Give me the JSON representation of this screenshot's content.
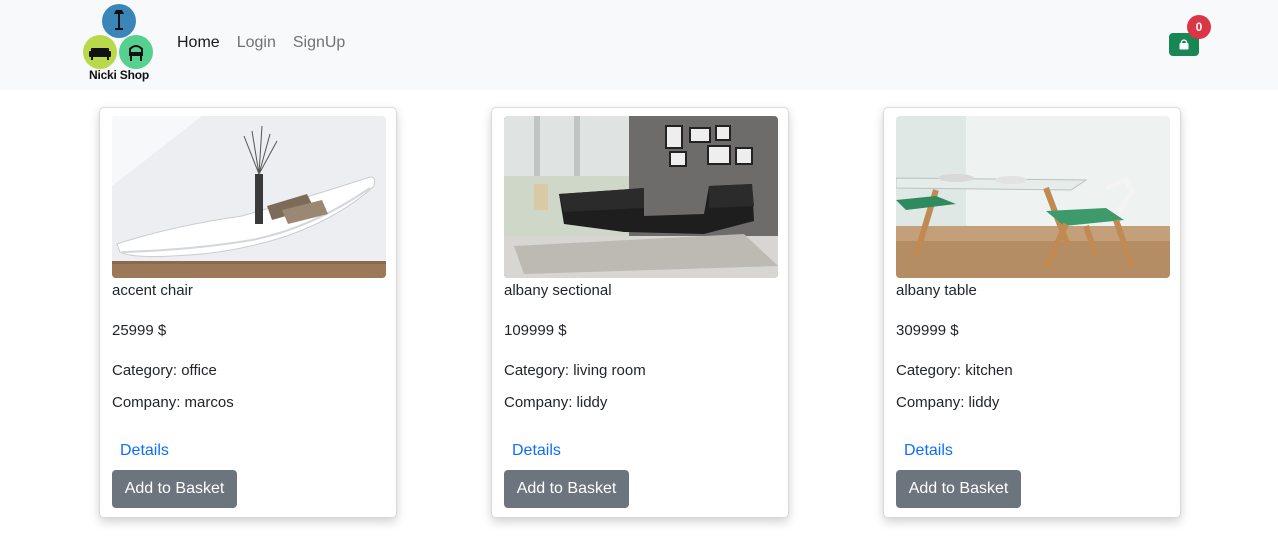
{
  "brand": {
    "name": "Nicki Shop"
  },
  "nav": {
    "items": [
      "Home",
      "Login",
      "SignUp"
    ],
    "active": "Home"
  },
  "cart": {
    "count": "0",
    "icon": "bag-icon",
    "color": "#198754",
    "badge_color": "#dc3545"
  },
  "products": [
    {
      "title": "accent chair",
      "price": "25999 $",
      "category": "Category: office",
      "company": "Company: marcos",
      "details_label": "Details",
      "button_label": "Add to Basket"
    },
    {
      "title": "albany sectional",
      "price": "109999 $",
      "category": "Category: living room",
      "company": "Company: liddy",
      "details_label": "Details",
      "button_label": "Add to Basket"
    },
    {
      "title": "albany table",
      "price": "309999 $",
      "category": "Category: kitchen",
      "company": "Company: liddy",
      "details_label": "Details",
      "button_label": "Add to Basket"
    }
  ]
}
